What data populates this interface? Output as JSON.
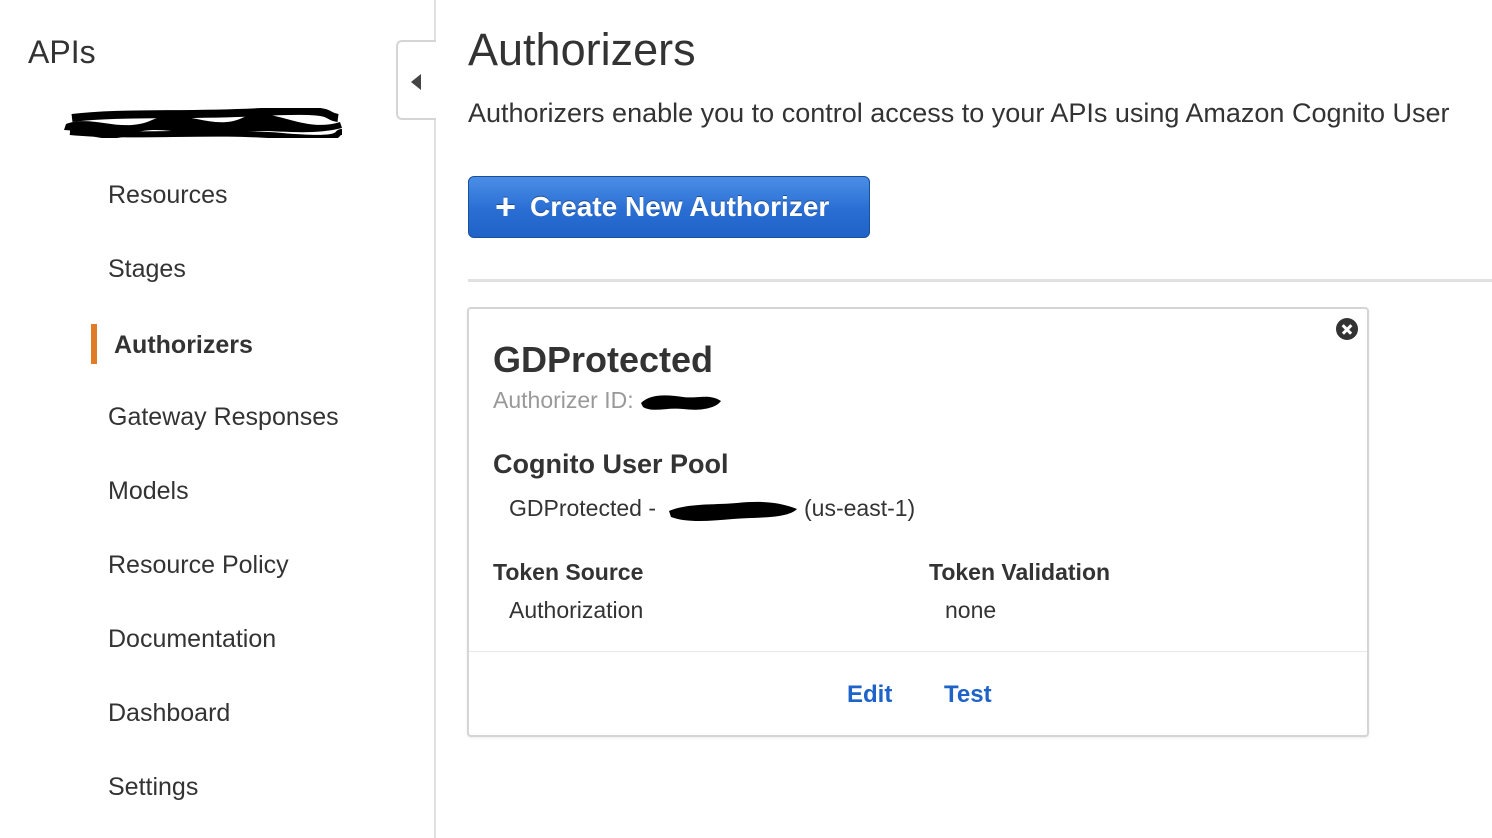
{
  "sidebar": {
    "title": "APIs",
    "items": [
      {
        "label": "Resources"
      },
      {
        "label": "Stages"
      },
      {
        "label": "Authorizers",
        "active": true
      },
      {
        "label": "Gateway Responses"
      },
      {
        "label": "Models"
      },
      {
        "label": "Resource Policy"
      },
      {
        "label": "Documentation"
      },
      {
        "label": "Dashboard"
      },
      {
        "label": "Settings"
      }
    ]
  },
  "main": {
    "title": "Authorizers",
    "description": "Authorizers enable you to control access to your APIs using Amazon Cognito User",
    "create_button_label": "Create New Authorizer"
  },
  "authorizer": {
    "name": "GDProtected",
    "id_label": "Authorizer ID:",
    "pool_heading": "Cognito User Pool",
    "pool_value_prefix": "GDProtected -",
    "pool_value_suffix": "(us-east-1)",
    "token_source_label": "Token Source",
    "token_source_value": "Authorization",
    "token_validation_label": "Token Validation",
    "token_validation_value": "none",
    "edit_label": "Edit",
    "test_label": "Test"
  },
  "colors": {
    "accent_orange": "#e07b28",
    "primary_blue": "#1f63c8",
    "link_blue": "#1f63c8"
  },
  "icons": {
    "collapse": "caret-left-icon",
    "create": "plus-icon",
    "close": "close-circle-icon"
  }
}
